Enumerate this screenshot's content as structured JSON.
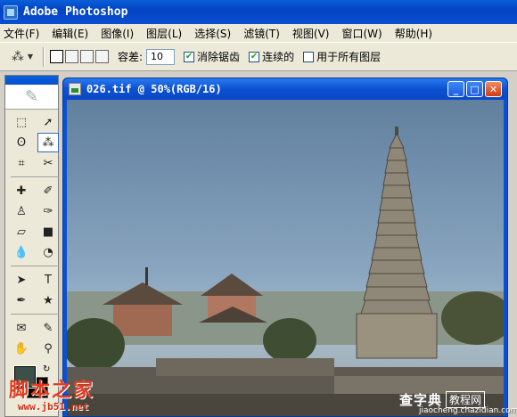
{
  "app": {
    "title": "Adobe Photoshop"
  },
  "menu": [
    "文件(F)",
    "编辑(E)",
    "图像(I)",
    "图层(L)",
    "选择(S)",
    "滤镜(T)",
    "视图(V)",
    "窗口(W)",
    "帮助(H)"
  ],
  "options": {
    "tolerance_label": "容差:",
    "tolerance_value": "10",
    "antialias_label": "消除锯齿",
    "antialias_checked": true,
    "contiguous_label": "连续的",
    "contiguous_checked": true,
    "all_layers_label": "用于所有图层",
    "all_layers_checked": false
  },
  "toolbox": {
    "active_tool": "magic-wand",
    "foreground_color": "#3c5048",
    "background_color": "#000000"
  },
  "document": {
    "title": "026.tif @ 50%(RGB/16)",
    "image": "pagoda-temple-photo"
  },
  "watermark": {
    "left_text": "脚本之家",
    "left_url": "www.jb51.net",
    "right_text": "查字典",
    "right_badge": "教程网",
    "right_url": "jiaocheng.chazidian.com"
  }
}
